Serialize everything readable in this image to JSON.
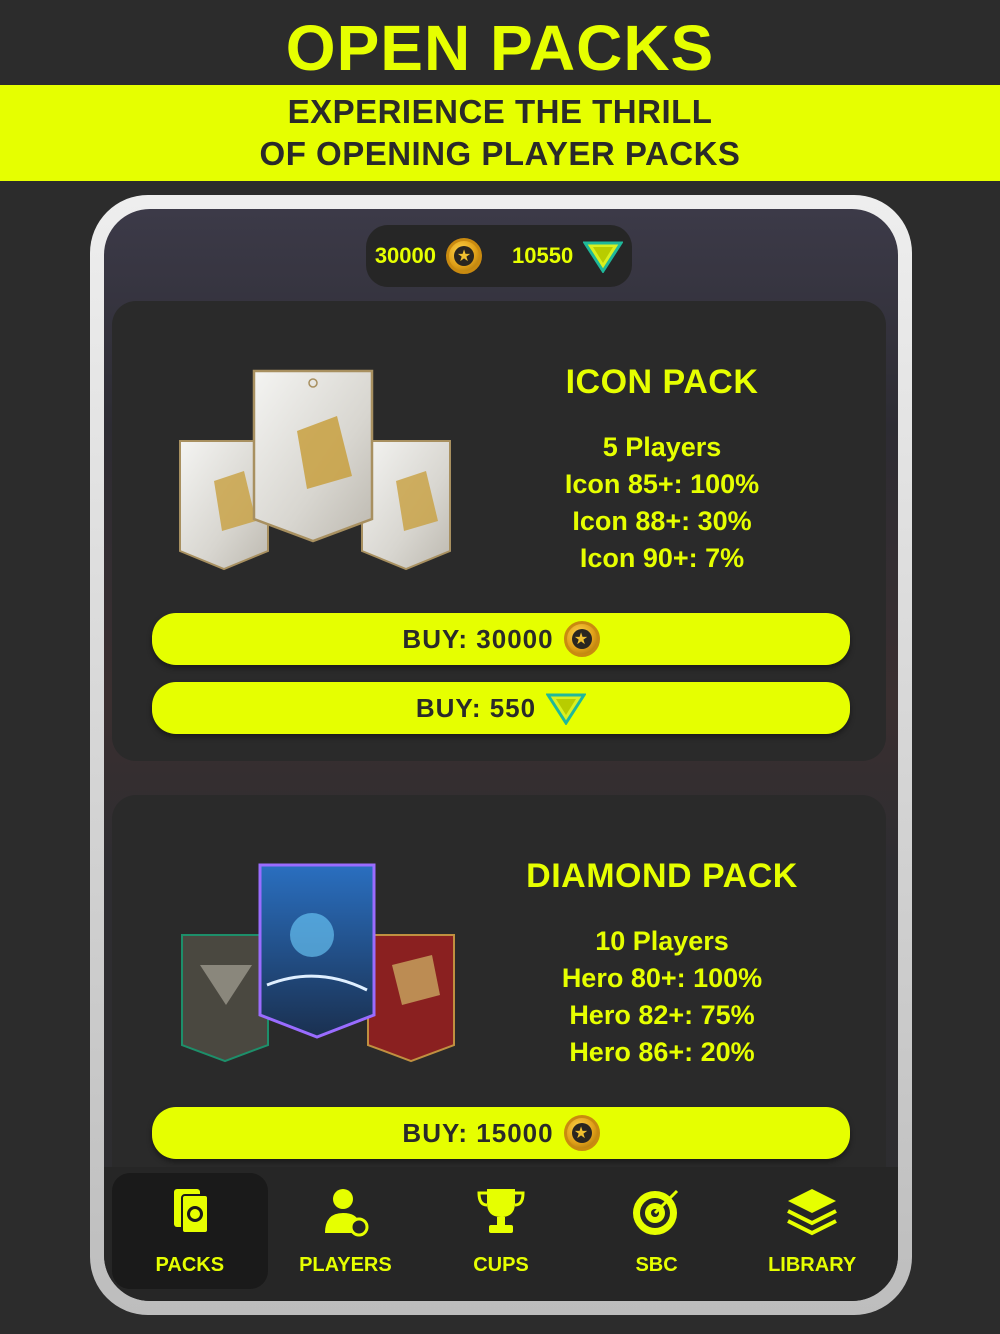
{
  "headline": "OPEN PACKS",
  "tagline": {
    "line1": "EXPERIENCE THE THRILL",
    "line2": "OF OPENING PLAYER PACKS"
  },
  "currency": {
    "coins": "30000",
    "coin_icon": "coin-icon",
    "gems": "10550",
    "gem_icon": "gem-icon"
  },
  "packs": [
    {
      "title": "ICON PACK",
      "lines": [
        "5 Players",
        "Icon 85+: 100%",
        "Icon 88+: 30%",
        "Icon 90+: 7%"
      ],
      "buy_coins": "BUY: 30000",
      "buy_gems": "BUY: 550"
    },
    {
      "title": "DIAMOND PACK",
      "lines": [
        "10 Players",
        "Hero 80+: 100%",
        "Hero 82+: 75%",
        "Hero 86+: 20%"
      ],
      "buy_coins": "BUY: 15000"
    }
  ],
  "tabs": [
    {
      "label": "PACKS",
      "icon": "packs-icon",
      "active": true
    },
    {
      "label": "PLAYERS",
      "icon": "players-icon",
      "active": false
    },
    {
      "label": "CUPS",
      "icon": "trophy-icon",
      "active": false
    },
    {
      "label": "SBC",
      "icon": "target-icon",
      "active": false
    },
    {
      "label": "LIBRARY",
      "icon": "layers-icon",
      "active": false
    }
  ],
  "colors": {
    "accent": "#e6ff00",
    "background": "#2c2c2c",
    "card": "#2a2a2a"
  }
}
